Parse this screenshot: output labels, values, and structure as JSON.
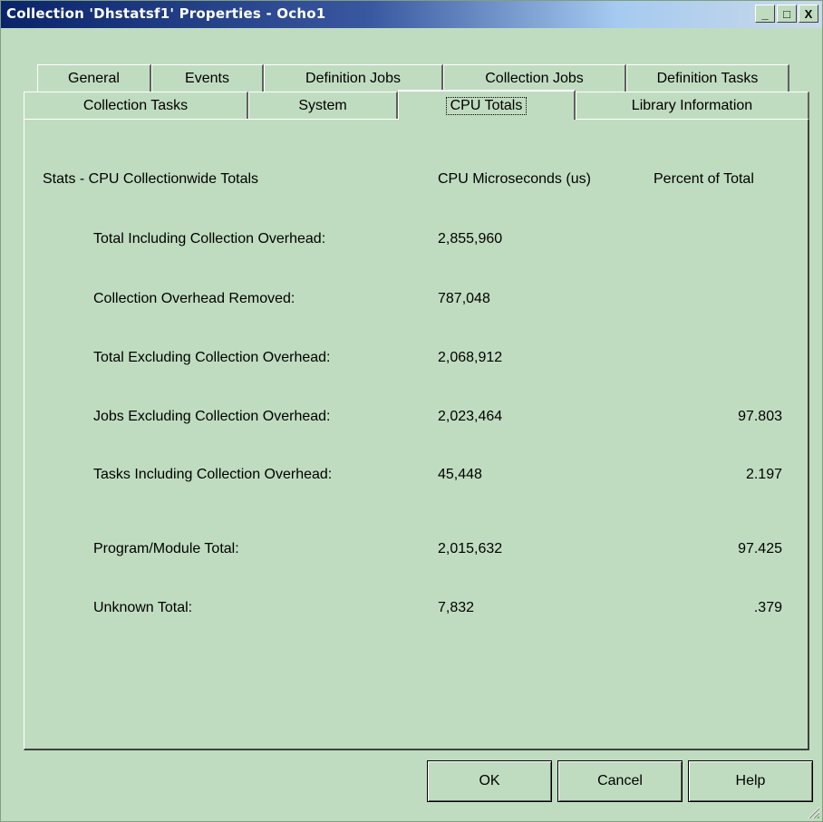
{
  "window": {
    "title": "Collection 'Dhstatsf1' Properties - Ocho1",
    "buttons": [
      "_",
      "□",
      "X"
    ]
  },
  "tabs_row1": [
    "General",
    "Events",
    "Definition Jobs",
    "Collection Jobs",
    "Definition Tasks"
  ],
  "tabs_row2": [
    "Collection Tasks",
    "System",
    "CPU Totals",
    "Library Information"
  ],
  "active_tab": "CPU Totals",
  "section": {
    "title": "Stats - CPU Collectionwide Totals",
    "col_us": "CPU Microseconds (us)",
    "col_pct": "Percent of Total"
  },
  "rows": [
    {
      "label": "Total Including Collection Overhead:",
      "us": "2,855,960",
      "pct": ""
    },
    {
      "label": "Collection Overhead Removed:",
      "us": "787,048",
      "pct": ""
    },
    {
      "label": "Total Excluding Collection Overhead:",
      "us": "2,068,912",
      "pct": ""
    },
    {
      "label": "Jobs Excluding Collection Overhead:",
      "us": "2,023,464",
      "pct": "97.803"
    },
    {
      "label": "Tasks Including Collection Overhead:",
      "us": "45,448",
      "pct": "2.197"
    },
    {
      "label": "Program/Module Total:",
      "us": "2,015,632",
      "pct": "97.425"
    },
    {
      "label": "Unknown Total:",
      "us": "7,832",
      "pct": ".379"
    }
  ],
  "buttons": {
    "ok": "OK",
    "cancel": "Cancel",
    "help": "Help"
  },
  "colors": {
    "background": "#c0dcc0",
    "title_start": "#0a246a",
    "title_end": "#c9d9e8"
  }
}
